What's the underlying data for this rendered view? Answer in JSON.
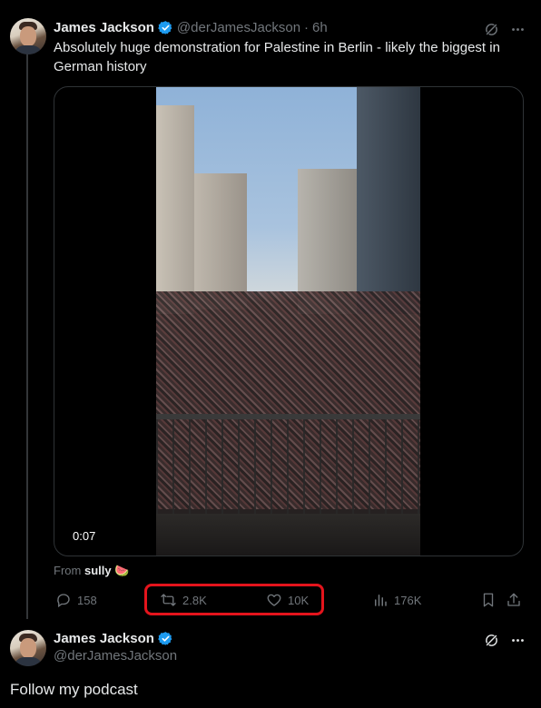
{
  "tweet": {
    "author_name": "James Jackson",
    "handle": "@derJamesJackson",
    "separator": "·",
    "time": "6h",
    "text": "Absolutely huge demonstration for Palestine in Berlin - likely the biggest in German history",
    "video_time": "0:07",
    "from_label": "From",
    "from_user": "sully 🍉",
    "replies": "158",
    "reposts": "2.8K",
    "likes": "10K",
    "views": "176K"
  },
  "reply": {
    "author_name": "James Jackson",
    "handle": "@derJamesJackson",
    "text": "Follow my podcast"
  },
  "colors": {
    "background": "#000000",
    "text": "#e7e9ea",
    "muted": "#71767b",
    "verified": "#1d9bf0",
    "highlight": "#e4141c"
  }
}
